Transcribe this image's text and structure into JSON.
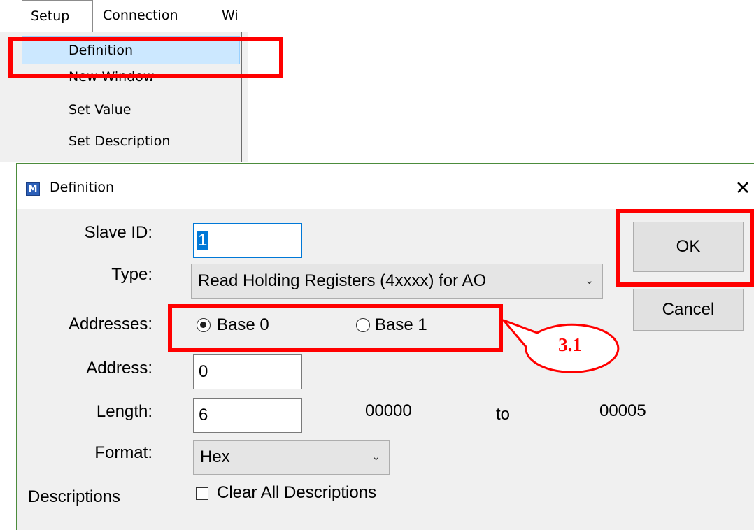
{
  "menubar": {
    "items": [
      {
        "label": "Setup"
      },
      {
        "label": "Connection"
      },
      {
        "label": "Wi"
      }
    ]
  },
  "setup_menu": {
    "items": [
      {
        "label": "Definition"
      },
      {
        "label": "New Window"
      },
      {
        "label": "Set Value"
      },
      {
        "label": "Set Description"
      }
    ]
  },
  "dialog": {
    "title": "Definition",
    "app_icon_letter": "M",
    "close_glyph": "✕",
    "slave_id": {
      "label": "Slave ID:",
      "value": "1"
    },
    "type": {
      "label": "Type:",
      "selected": "Read Holding Registers (4xxxx) for AO"
    },
    "addresses": {
      "label": "Addresses:",
      "base0": "Base 0",
      "base1": "Base 1",
      "selected": "Base 0"
    },
    "address": {
      "label": "Address:",
      "value": "0"
    },
    "length": {
      "label": "Length:",
      "value": "6",
      "range_start": "00000",
      "range_to": "to",
      "range_end": "00005"
    },
    "format": {
      "label": "Format:",
      "selected": "Hex"
    },
    "descriptions": {
      "label": "Descriptions",
      "checkbox_label": "Clear All Descriptions",
      "checked": false
    },
    "buttons": {
      "ok": "OK",
      "cancel": "Cancel"
    }
  },
  "annotation": {
    "callout_label": "3.1",
    "highlight_color": "#ff0000"
  },
  "colors": {
    "accent": "#0078d7",
    "menu_highlight": "#cce8ff",
    "dialog_bg": "#f0f0f0"
  }
}
